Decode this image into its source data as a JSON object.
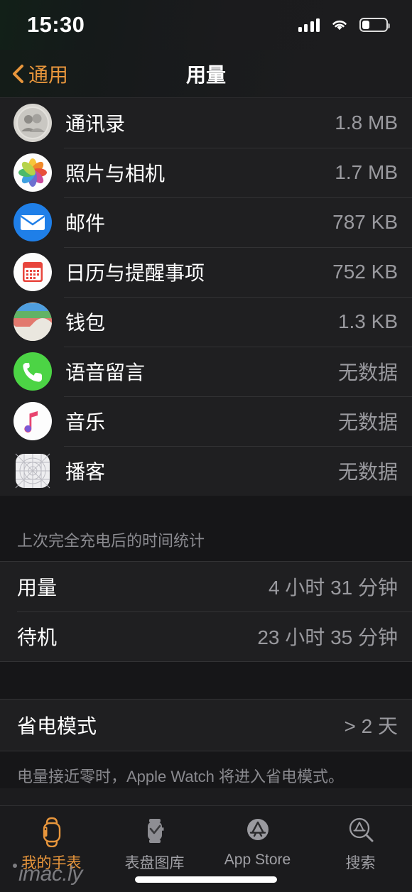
{
  "status_bar": {
    "time": "15:30",
    "signal_icon": "cellular-bars-icon",
    "wifi_icon": "wifi-icon",
    "battery_icon": "battery-icon",
    "battery_level_pct": 30
  },
  "nav": {
    "back_label": "通用",
    "back_icon": "chevron-left-icon",
    "title": "用量",
    "accent_color": "#e8963c"
  },
  "app_storage": {
    "rows": [
      {
        "icon": "contacts-icon",
        "label": "通讯录",
        "value": "1.8 MB"
      },
      {
        "icon": "photos-icon",
        "label": "照片与相机",
        "value": "1.7 MB"
      },
      {
        "icon": "mail-icon",
        "label": "邮件",
        "value": "787 KB"
      },
      {
        "icon": "calendar-icon",
        "label": "日历与提醒事项",
        "value": "752 KB"
      },
      {
        "icon": "wallet-icon",
        "label": "钱包",
        "value": "1.3 KB"
      },
      {
        "icon": "voicemail-icon",
        "label": "语音留言",
        "value": "无数据"
      },
      {
        "icon": "music-icon",
        "label": "音乐",
        "value": "无数据"
      },
      {
        "icon": "podcasts-icon",
        "label": "播客",
        "value": "无数据"
      }
    ]
  },
  "time_since_charge": {
    "header": "上次完全充电后的时间统计",
    "rows": [
      {
        "label": "用量",
        "value": "4 小时 31 分钟"
      },
      {
        "label": "待机",
        "value": "23 小时 35 分钟"
      }
    ]
  },
  "power_reserve": {
    "rows": [
      {
        "label": "省电模式",
        "value": "> 2 天"
      }
    ],
    "footer": "电量接近零时，Apple Watch 将进入省电模式。"
  },
  "tab_bar": {
    "tabs": [
      {
        "icon": "watch-icon",
        "label": "我的手表",
        "active": true
      },
      {
        "icon": "watch-face-icon",
        "label": "表盘图库",
        "active": false
      },
      {
        "icon": "app-store-icon",
        "label": "App Store",
        "active": false
      },
      {
        "icon": "app-store-search-icon",
        "label": "搜索",
        "active": false
      }
    ]
  },
  "watermark": {
    "text": "imac.ly"
  }
}
